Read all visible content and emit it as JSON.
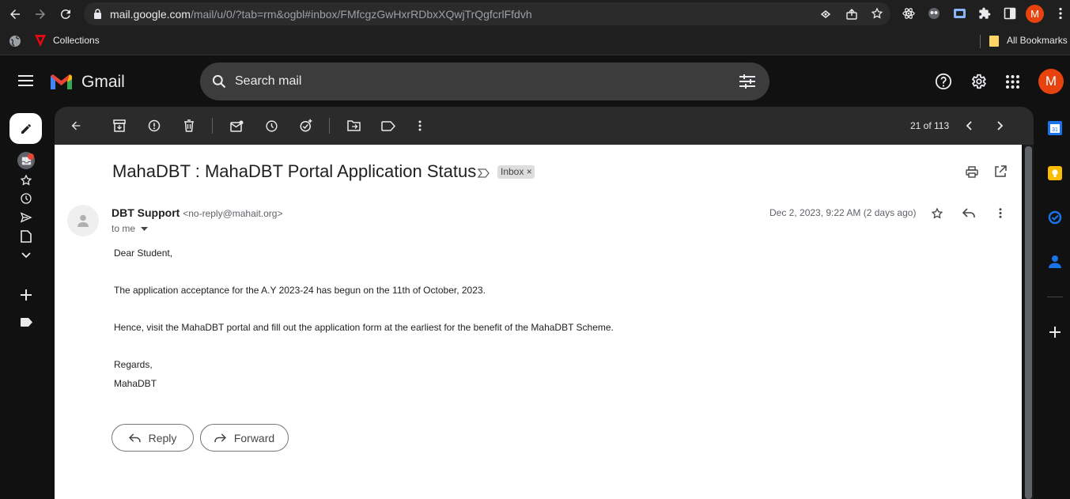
{
  "browser": {
    "url_host": "mail.google.com",
    "url_path": "/mail/u/0/?tab=rm&ogbl#inbox/FMfcgzGwHxrRDbxXQwjTrQgfcrlFfdvh",
    "profile_initial": "M"
  },
  "bookmarks": {
    "collections_label": "Collections",
    "all_bookmarks_label": "All Bookmarks"
  },
  "gmail": {
    "app_name": "Gmail",
    "search_placeholder": "Search mail",
    "account_initial": "M"
  },
  "toolbar": {
    "pager": "21 of 113"
  },
  "email": {
    "subject": "MahaDBT : MahaDBT Portal Application Status",
    "label": "Inbox",
    "label_remove": "×",
    "sender_name": "DBT Support",
    "sender_email": "<no-reply@mahait.org>",
    "to": "to me",
    "date": "Dec 2, 2023, 9:22 AM (2 days ago)",
    "body": {
      "greeting": "Dear Student,",
      "para1": "The application acceptance for the A.Y 2023-24 has begun on the 11th of October, 2023.",
      "para2": "Hence, visit the MahaDBT portal and fill out the application form at the earliest for the benefit of the MahaDBT Scheme.",
      "closing": "Regards,",
      "signature": "MahaDBT"
    },
    "reply_label": "Reply",
    "forward_label": "Forward"
  },
  "side_panel": {
    "calendar_day": "31"
  },
  "colors": {
    "avatar": "#e8430e",
    "calendar": "#1a73e8",
    "keep": "#fbbc04",
    "tasks": "#1a73e8",
    "contacts": "#1a73e8"
  }
}
